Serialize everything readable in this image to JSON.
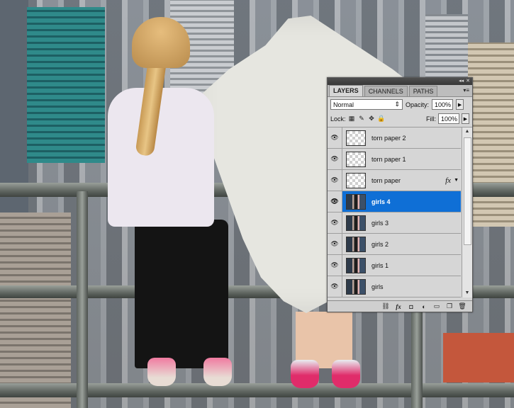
{
  "panel": {
    "tabs": [
      {
        "label": "LAYERS",
        "active": true
      },
      {
        "label": "CHANNELS",
        "active": false
      },
      {
        "label": "PATHS",
        "active": false
      }
    ],
    "blend_mode": "Normal",
    "opacity_label": "Opacity:",
    "opacity_value": "100%",
    "lock_label": "Lock:",
    "fill_label": "Fill:",
    "fill_value": "100%",
    "layers": [
      {
        "name": "torn paper 2",
        "thumb": "transparent",
        "selected": false
      },
      {
        "name": "torn paper 1",
        "thumb": "transparent",
        "selected": false
      },
      {
        "name": "torn paper",
        "thumb": "transparent",
        "selected": false,
        "effects": "fx"
      },
      {
        "name": "girls 4",
        "thumb": "photo",
        "selected": true
      },
      {
        "name": "girls 3",
        "thumb": "photo",
        "selected": false
      },
      {
        "name": "girls 2",
        "thumb": "photo",
        "selected": false
      },
      {
        "name": "girls 1",
        "thumb": "photo",
        "selected": false
      },
      {
        "name": "girls",
        "thumb": "photo",
        "selected": false
      }
    ],
    "bottom_icons": [
      "link-icon",
      "fx-icon",
      "mask-icon",
      "adjustment-icon",
      "folder-icon",
      "new-layer-icon",
      "trash-icon"
    ],
    "selection_color": "#0f6fd6"
  }
}
